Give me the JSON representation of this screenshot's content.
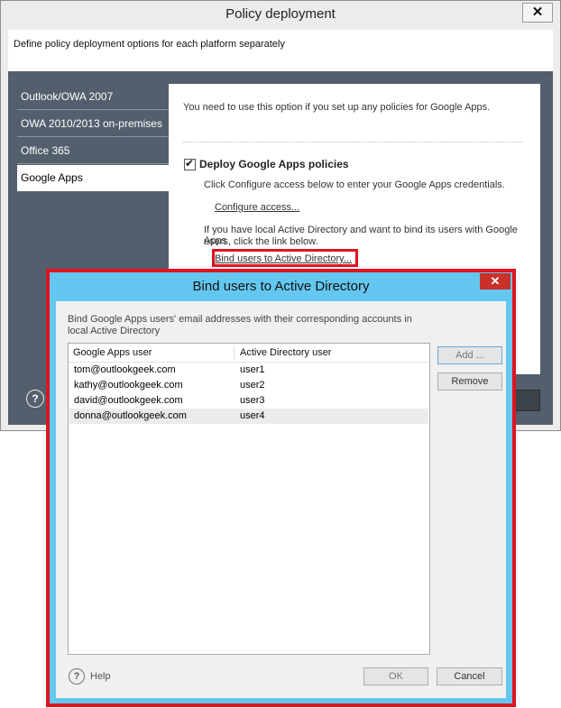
{
  "main_window": {
    "title": "Policy deployment",
    "close_glyph": "✕",
    "intro": "Define policy deployment options for each platform separately",
    "nav_items": [
      {
        "label": "Outlook/OWA 2007"
      },
      {
        "label": "OWA 2010/2013 on-premises"
      },
      {
        "label": "Office 365"
      },
      {
        "label": "Google Apps",
        "active": true
      }
    ],
    "content": {
      "info": "You need to use this option if you set up any policies for Google Apps.",
      "checkbox_label": "Deploy Google Apps policies",
      "checkbox_checked": true,
      "configure_text": "Click Configure access below to enter your Google Apps credentials.",
      "configure_link": "Configure access...",
      "ad_text_line1": "If you have local Active Directory and want to bind its users with Google Apps",
      "ad_text_line2": "users, click the link below.",
      "bind_link": "Bind users to Active Directory..."
    },
    "help_glyph": "?",
    "icons": {
      "help": "help-icon",
      "close": "close-icon",
      "checkbox": "checkbox"
    }
  },
  "dialog": {
    "title": "Bind users to Active Directory",
    "close_glyph": "✕",
    "description_line1": "Bind Google Apps users' email addresses with their corresponding accounts in",
    "description_line2": "local Active Directory",
    "columns": [
      "Google Apps user",
      "Active Directory user"
    ],
    "rows": [
      {
        "google_user": "tom@outlookgeek.com",
        "ad_user": "user1"
      },
      {
        "google_user": "kathy@outlookgeek.com",
        "ad_user": "user2"
      },
      {
        "google_user": "david@outlookgeek.com",
        "ad_user": "user3"
      },
      {
        "google_user": "donna@outlookgeek.com",
        "ad_user": "user4",
        "selected": true
      }
    ],
    "buttons": {
      "add": "Add ...",
      "remove": "Remove",
      "ok": "OK",
      "cancel": "Cancel"
    },
    "help_glyph": "?",
    "help_label": "Help"
  },
  "colors": {
    "panel_dark": "#535f6c",
    "dialog_frame": "#64c7ef",
    "highlight_red": "#e0131f",
    "link_blue": "#0000cc",
    "close_red": "#c9312a"
  }
}
